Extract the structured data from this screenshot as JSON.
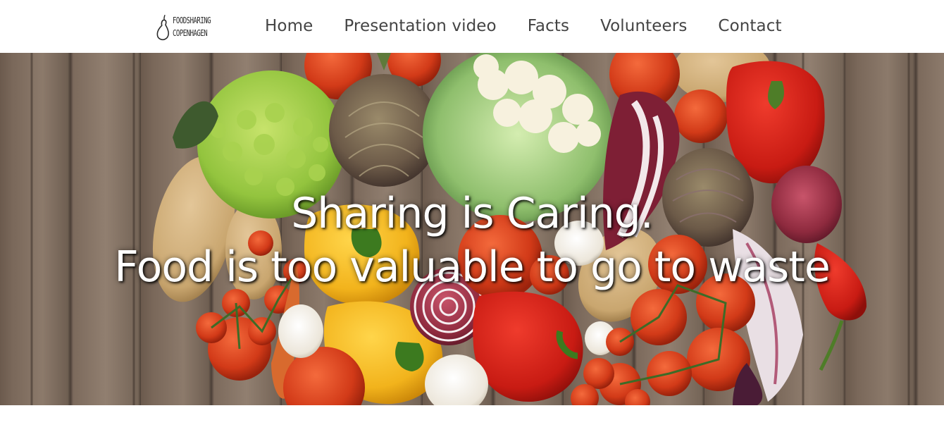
{
  "logo": {
    "line1": "Foodsharing",
    "line2": "Copenhagen",
    "icon": "pear-icon"
  },
  "nav": {
    "items": [
      {
        "label": "Home"
      },
      {
        "label": "Presentation video"
      },
      {
        "label": "Facts"
      },
      {
        "label": "Volunteers"
      },
      {
        "label": "Contact"
      }
    ]
  },
  "hero": {
    "image": "vegetables-on-wooden-table",
    "headline_line1": "Sharing is Caring.",
    "headline_line2": "Food is too valuable to go to waste"
  },
  "colors": {
    "nav_text": "#444444",
    "hero_text": "#ffffff",
    "wood": "#7a685a",
    "background": "#ffffff"
  }
}
